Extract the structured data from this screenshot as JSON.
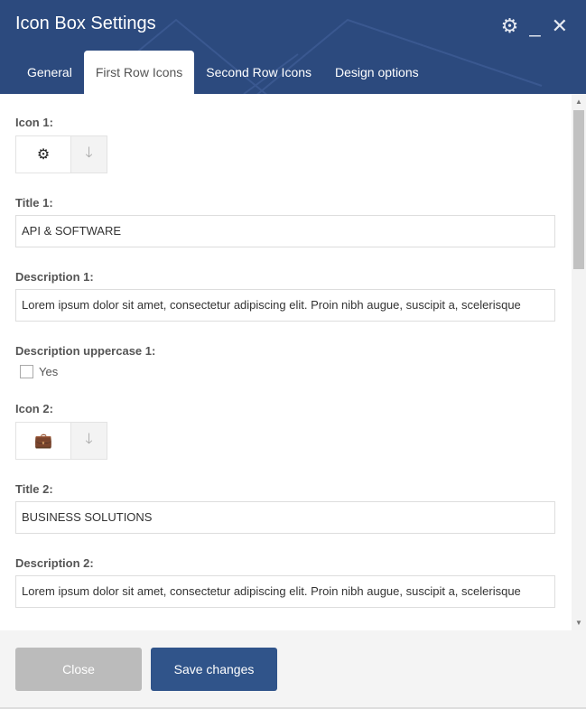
{
  "header": {
    "title": "Icon Box Settings",
    "icons": [
      "gear-icon",
      "minimize-icon",
      "close-icon"
    ]
  },
  "tabs": [
    {
      "label": "General"
    },
    {
      "label": "First Row Icons",
      "active": true
    },
    {
      "label": "Second Row Icons"
    },
    {
      "label": "Design options"
    }
  ],
  "fields": {
    "icon1": {
      "label": "Icon 1:",
      "icon": "cogs-icon"
    },
    "title1": {
      "label": "Title 1:",
      "value": "API & SOFTWARE"
    },
    "desc1": {
      "label": "Description 1:",
      "value": "Lorem ipsum dolor sit amet, consectetur adipiscing elit. Proin nibh augue, suscipit a, scelerisque"
    },
    "upper1": {
      "label": "Description uppercase 1:",
      "option": "Yes",
      "checked": false
    },
    "icon2": {
      "label": "Icon 2:",
      "icon": "briefcase-icon"
    },
    "title2": {
      "label": "Title 2:",
      "value": "BUSINESS SOLUTIONS"
    },
    "desc2": {
      "label": "Description 2:",
      "value": "Lorem ipsum dolor sit amet, consectetur adipiscing elit. Proin nibh augue, suscipit a, scelerisque"
    }
  },
  "footer": {
    "close": "Close",
    "save": "Save changes"
  },
  "colors": {
    "primary": "#2c4a7e",
    "save": "#30548a",
    "close": "#bbbbbb"
  }
}
